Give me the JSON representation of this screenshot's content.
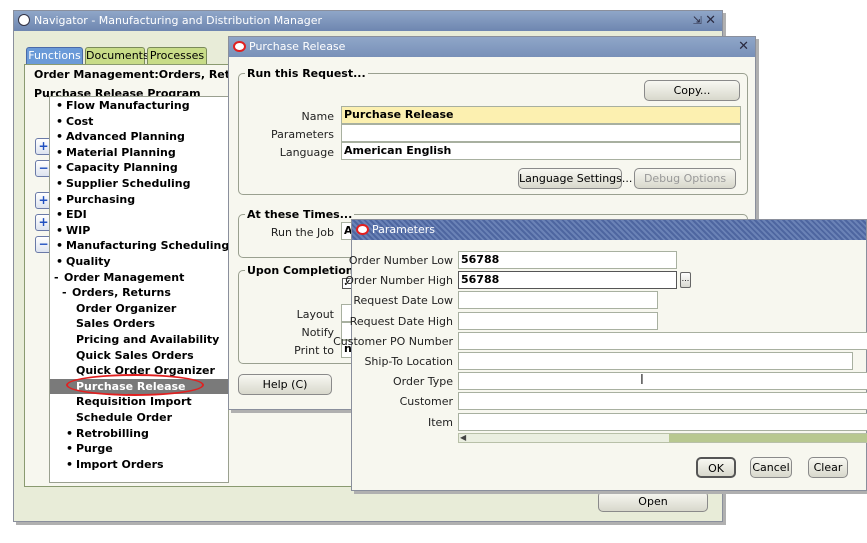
{
  "navigator": {
    "title": "Navigator - Manufacturing and Distribution Manager",
    "tabs": [
      {
        "label": "Functions"
      },
      {
        "label": "Documents"
      },
      {
        "label": "Processes"
      }
    ],
    "header_line1": "Order Management:Orders, Returns:Purc",
    "header_line2": "Purchase Release Program",
    "side_buttons": [
      "+",
      "−",
      "+",
      "+",
      "−"
    ],
    "tree": [
      {
        "label": "Flow Manufacturing",
        "prefix": "+"
      },
      {
        "label": "Cost",
        "prefix": "+"
      },
      {
        "label": "Advanced Planning",
        "prefix": "+"
      },
      {
        "label": "Material Planning",
        "prefix": "+"
      },
      {
        "label": "Capacity Planning",
        "prefix": "+"
      },
      {
        "label": "Supplier Scheduling",
        "prefix": "+"
      },
      {
        "label": "Purchasing",
        "prefix": "+"
      },
      {
        "label": "EDI",
        "prefix": "+"
      },
      {
        "label": "WIP",
        "prefix": "+"
      },
      {
        "label": "Manufacturing Scheduling",
        "prefix": "+"
      },
      {
        "label": "Quality",
        "prefix": "+"
      },
      {
        "label": "Order Management",
        "prefix": "-"
      },
      {
        "label": "Orders, Returns",
        "prefix": "-"
      },
      {
        "label": "Order Organizer",
        "prefix": ""
      },
      {
        "label": "Sales Orders",
        "prefix": ""
      },
      {
        "label": "Pricing and Availability",
        "prefix": ""
      },
      {
        "label": "Quick Sales Orders",
        "prefix": ""
      },
      {
        "label": "Quick Order Organizer",
        "prefix": ""
      },
      {
        "label": "Purchase Release",
        "prefix": ""
      },
      {
        "label": "Requisition Import",
        "prefix": ""
      },
      {
        "label": "Schedule Order",
        "prefix": ""
      },
      {
        "label": "Retrobilling",
        "prefix": "+"
      },
      {
        "label": "Purge",
        "prefix": "+"
      },
      {
        "label": "Import Orders",
        "prefix": "+"
      }
    ],
    "open_button": "Open"
  },
  "purchase_release": {
    "title": "Purchase Release",
    "run_group": "Run this Request...",
    "copy_button": "Copy...",
    "name_label": "Name",
    "name_value": "Purchase Release",
    "parameters_label": "Parameters",
    "parameters_value": "",
    "language_label": "Language",
    "language_value": "American English",
    "language_settings_button": "Language Settings...",
    "debug_options_button": "Debug Options",
    "times_group": "At these Times...",
    "run_job_label": "Run the Job",
    "run_job_value": "A",
    "completion_group": "Upon Completion...",
    "layout_label": "Layout",
    "notify_label": "Notify",
    "print_to_label": "Print to",
    "print_to_value": "n",
    "help_button": "Help (C)"
  },
  "parameters": {
    "title": "Parameters",
    "fields": [
      {
        "label": "Order Number Low",
        "value": "56788"
      },
      {
        "label": "Order Number High",
        "value": "56788"
      },
      {
        "label": "Request Date Low",
        "value": ""
      },
      {
        "label": "Request Date High",
        "value": ""
      },
      {
        "label": "Customer PO Number",
        "value": ""
      },
      {
        "label": "Ship-To Location",
        "value": ""
      },
      {
        "label": "Order Type",
        "value": ""
      },
      {
        "label": "Customer",
        "value": ""
      },
      {
        "label": "Item",
        "value": ""
      }
    ],
    "lov_button": "...",
    "ok_button": "OK",
    "cancel_button": "Cancel",
    "clear_button": "Clear"
  },
  "colors": {
    "window_bg": "#f7f7ef",
    "title_blue": "#7890b8",
    "required_yellow": "#fcf0b0",
    "selection_gray": "#7a7a7a",
    "highlight_red": "#e02020"
  }
}
